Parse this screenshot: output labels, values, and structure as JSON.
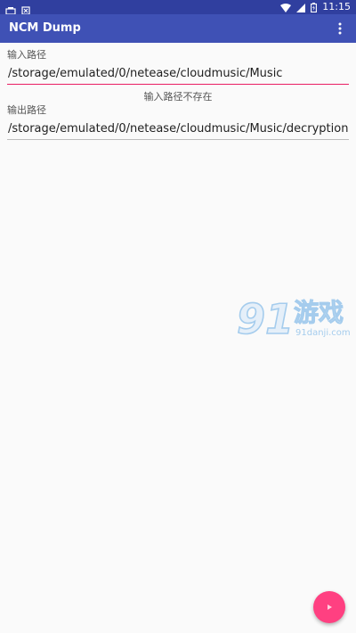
{
  "status_bar": {
    "time": "11:15",
    "icons": [
      "notification-icon",
      "download-icon",
      "wifi-icon",
      "signal-icon",
      "battery-icon"
    ]
  },
  "app_bar": {
    "title": "NCM Dump",
    "menu_icon": "more-vert-icon"
  },
  "input_path": {
    "label": "输入路径",
    "value": "/storage/emulated/0/netease/cloudmusic/Music",
    "error": "输入路径不存在"
  },
  "output_path": {
    "label": "输出路径",
    "value": "/storage/emulated/0/netease/cloudmusic/Music/decryption"
  },
  "watermark": {
    "number": "91",
    "title": "游戏",
    "site": "91danji.com"
  },
  "fab": {
    "icon": "play-icon"
  },
  "colors": {
    "primary": "#3f51b5",
    "primary_dark": "#303f9f",
    "accent": "#ff4081",
    "error_line": "#e91e63"
  }
}
